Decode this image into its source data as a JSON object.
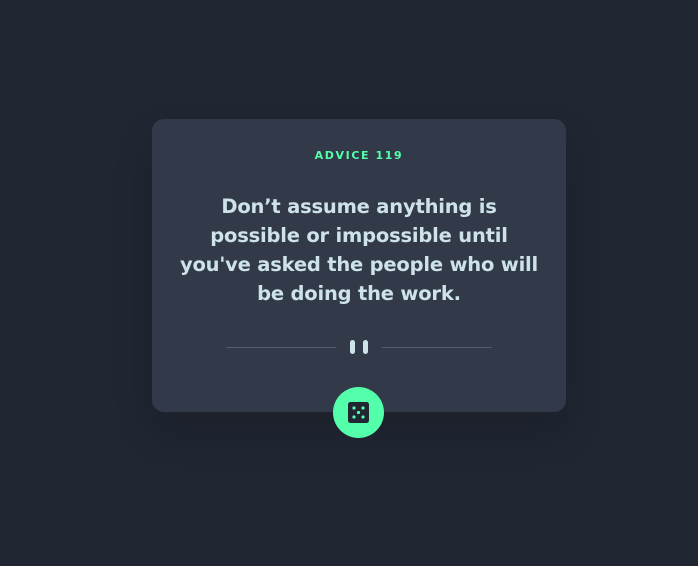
{
  "advice": {
    "id_label": "ADVICE 119",
    "text": "Don’t assume anything is possible or impossible until you've asked the people who will be doing the work."
  },
  "colors": {
    "background": "#202632",
    "card": "#323a49",
    "accent": "#53ffaa",
    "text": "#cee3e9",
    "divider": "#4f5d74"
  },
  "icons": {
    "divider": "pause-divider-icon",
    "button": "dice-icon"
  }
}
